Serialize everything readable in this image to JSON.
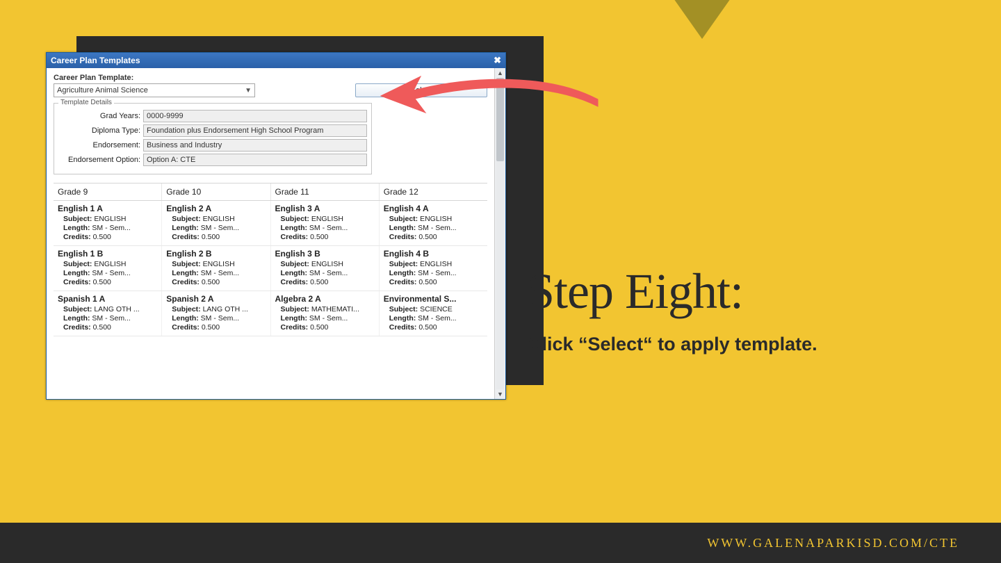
{
  "slide": {
    "title": "Step Eight:",
    "subtitle": "Click “Select“ to apply template.",
    "footer_url": "WWW.GALENAPARKISD.COM/CTE"
  },
  "window": {
    "title": "Career Plan Templates",
    "template_label": "Career Plan Template:",
    "template_value": "Agriculture Animal Science",
    "select_button": "Select",
    "fieldset_legend": "Template Details",
    "details": [
      {
        "label": "Grad Years:",
        "value": "0000-9999"
      },
      {
        "label": "Diploma Type:",
        "value": "Foundation plus Endorsement High School Program"
      },
      {
        "label": "Endorsement:",
        "value": "Business and Industry"
      },
      {
        "label": "Endorsement Option:",
        "value": "Option A: CTE"
      }
    ],
    "grade_headers": [
      "Grade 9",
      "Grade 10",
      "Grade 11",
      "Grade 12"
    ],
    "meta_labels": {
      "subject": "Subject:",
      "length": "Length:",
      "credits": "Credits:"
    },
    "rows": [
      [
        {
          "title": "English 1 A",
          "subject": "ENGLISH",
          "length": "SM - Sem...",
          "credits": "0.500"
        },
        {
          "title": "English 2 A",
          "subject": "ENGLISH",
          "length": "SM - Sem...",
          "credits": "0.500"
        },
        {
          "title": "English 3 A",
          "subject": "ENGLISH",
          "length": "SM - Sem...",
          "credits": "0.500"
        },
        {
          "title": "English 4 A",
          "subject": "ENGLISH",
          "length": "SM - Sem...",
          "credits": "0.500"
        }
      ],
      [
        {
          "title": "English 1 B",
          "subject": "ENGLISH",
          "length": "SM - Sem...",
          "credits": "0.500"
        },
        {
          "title": "English 2 B",
          "subject": "ENGLISH",
          "length": "SM - Sem...",
          "credits": "0.500"
        },
        {
          "title": "English 3 B",
          "subject": "ENGLISH",
          "length": "SM - Sem...",
          "credits": "0.500"
        },
        {
          "title": "English 4 B",
          "subject": "ENGLISH",
          "length": "SM - Sem...",
          "credits": "0.500"
        }
      ],
      [
        {
          "title": "Spanish 1 A",
          "subject": "LANG OTH ...",
          "length": "SM - Sem...",
          "credits": "0.500"
        },
        {
          "title": "Spanish 2 A",
          "subject": "LANG OTH ...",
          "length": "SM - Sem...",
          "credits": "0.500"
        },
        {
          "title": "Algebra 2 A",
          "subject": "MATHEMATI...",
          "length": "SM - Sem...",
          "credits": "0.500"
        },
        {
          "title": "Environmental S...",
          "subject": "SCIENCE",
          "length": "SM - Sem...",
          "credits": "0.500"
        }
      ]
    ]
  }
}
